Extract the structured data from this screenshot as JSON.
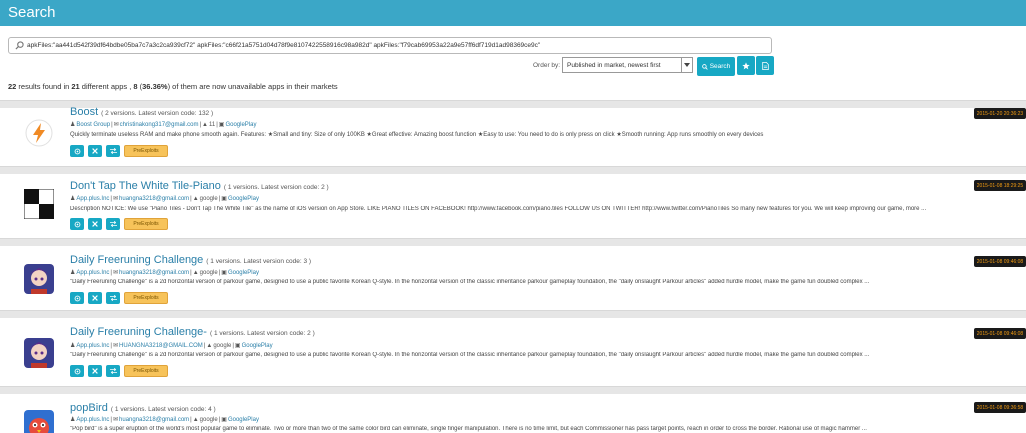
{
  "header": {
    "title": "Search"
  },
  "search": {
    "query": "apkFiles:\"aa441d542f39df64bdbe05ba7c7a3c2ca939cf72\" apkFiles:\"c66f21a5751d04d78f9e8107422558916c98a982d\" apkFiles:\"f79cab69953a22a9e57ff6df719d1ad98369ce9c\"",
    "order_label": "Order by:",
    "order_value": "Published in market, newest first",
    "search_button": "Search"
  },
  "results": {
    "total": "22",
    "text1": " results found in ",
    "apps": "21",
    "text2": " different apps , ",
    "unavailable": "8",
    "text3": " (",
    "percent": "36.36%",
    "text4": ") of them are now unavailable apps in their markets"
  },
  "items": [
    {
      "name": "Boost",
      "meta": "( 2 versions. Latest version code: 132 )",
      "developer": "Boost Group",
      "email": "christinakong317@gmail.com",
      "ver": "11",
      "market": "GooglePlay",
      "desc": "Quickly terminate useless RAM and make phone smooth again. Features: ★Small and tiny: Size of only 100KB ★Great effective: Amazing boost function ★Easy to use: You need to do is only press on click ★Smooth running: App runs smoothly on every devices",
      "date": "2015-01-20 20:36:23",
      "pre": "PreExploits"
    },
    {
      "name": "Don't Tap The White Tile-Piano",
      "meta": "( 1 versions. Latest version code: 2 )",
      "developer": "App.plus.Inc",
      "email": "huangna3218@gmail.com",
      "ver": "google",
      "market": "GooglePlay",
      "desc": "Description NOTICE:  We use \"Piano Tiles - Don't Tap The White Tile\" as the name of iOS version on App Store. LIKE PIANO TILES ON FACEBOOK! http://www.facebook.com/piano.tiles FOLLOW US ON TWITTER! http://www.twitter.com/PianoTiles So many new features for you. We will keep improving our game, more ...",
      "date": "2015-01-08 18:29:25",
      "pre": "PreExploits"
    },
    {
      "name": "Daily Freeruning Challenge",
      "meta": "( 1 versions. Latest version code: 3 )",
      "developer": "App.plus.Inc",
      "email": "huangna3218@gmail.com",
      "ver": "google",
      "market": "GooglePlay",
      "desc": "\"Daily Freeruning Challenge\" is a 2d horizontal version of parkour game, designed to use a public favorite Korean Q-style. In the horizontal version of the classic inheritance parkour gameplay foundation, the \"daily onslaught Parkour articles\" added hurdle model, make the game fun doubled complex ...",
      "date": "2015-01-08 09:46:08",
      "pre": "PreExploits"
    },
    {
      "name": "Daily Freeruning Challenge-",
      "meta": "( 1 versions. Latest version code: 2 )",
      "developer": "App.plus.Inc",
      "email": "HUANGNA3218@GMAIL.COM",
      "ver": "google",
      "market": "GooglePlay",
      "desc": "\"Daily Freeruning Challenge\" is a 2d horizontal version of parkour game, designed to use a public favorite Korean Q-style. In the horizontal version of the classic inheritance parkour gameplay foundation, the \"daily onslaught Parkour articles\" added hurdle model, make the game fun doubled complex ...",
      "date": "2015-01-08 09:46:08",
      "pre": "PreExploits"
    },
    {
      "name": "popBird",
      "meta": "( 1 versions. Latest version code: 4 )",
      "developer": "App.plus.Inc",
      "email": "huangna3218@gmail.com",
      "ver": "google",
      "market": "GooglePlay",
      "desc": "\"Pop bird\" is a super eruption of the world's most popular game to eliminate. Two or more than two of the same color bird can eliminate, single finger manipulation. There is no time limit, but each Commissioner has pass target points, reach in order to cross the border. Rational use of magic hammer ...",
      "date": "2015-01-08 09:36:58",
      "pre": "PreExploits"
    }
  ]
}
